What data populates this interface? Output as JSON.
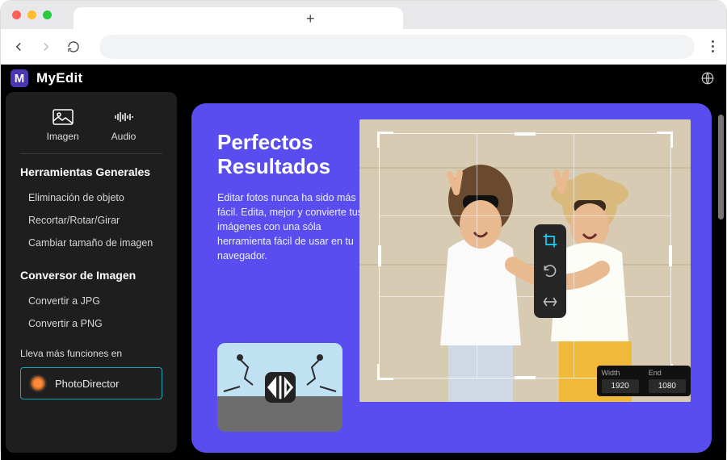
{
  "app": {
    "brand": "MyEdit"
  },
  "sidebar": {
    "media": {
      "image": "Imagen",
      "audio": "Audio"
    },
    "section1_title": "Herramientas Generales",
    "tools1": [
      "Eliminación de objeto",
      "Recortar/Rotar/Girar",
      "Cambiar tamaño de imagen"
    ],
    "section2_title": "Conversor de Imagen",
    "tools2": [
      "Convertir a JPG",
      "Convertir a PNG"
    ],
    "promo_line": "Lleva más funciones en",
    "promo_button": "PhotoDirector"
  },
  "hero": {
    "title_l1": "Perfectos",
    "title_l2": "Resultados",
    "body": "Editar fotos nunca ha sido más fácil. Edita, mejor y convierte tus imágenes con una sóla herramienta fácil de usar en tu navegador."
  },
  "dims": {
    "width_label": "Width",
    "width_value": "1920",
    "end_label": "End",
    "end_value": "1080"
  }
}
